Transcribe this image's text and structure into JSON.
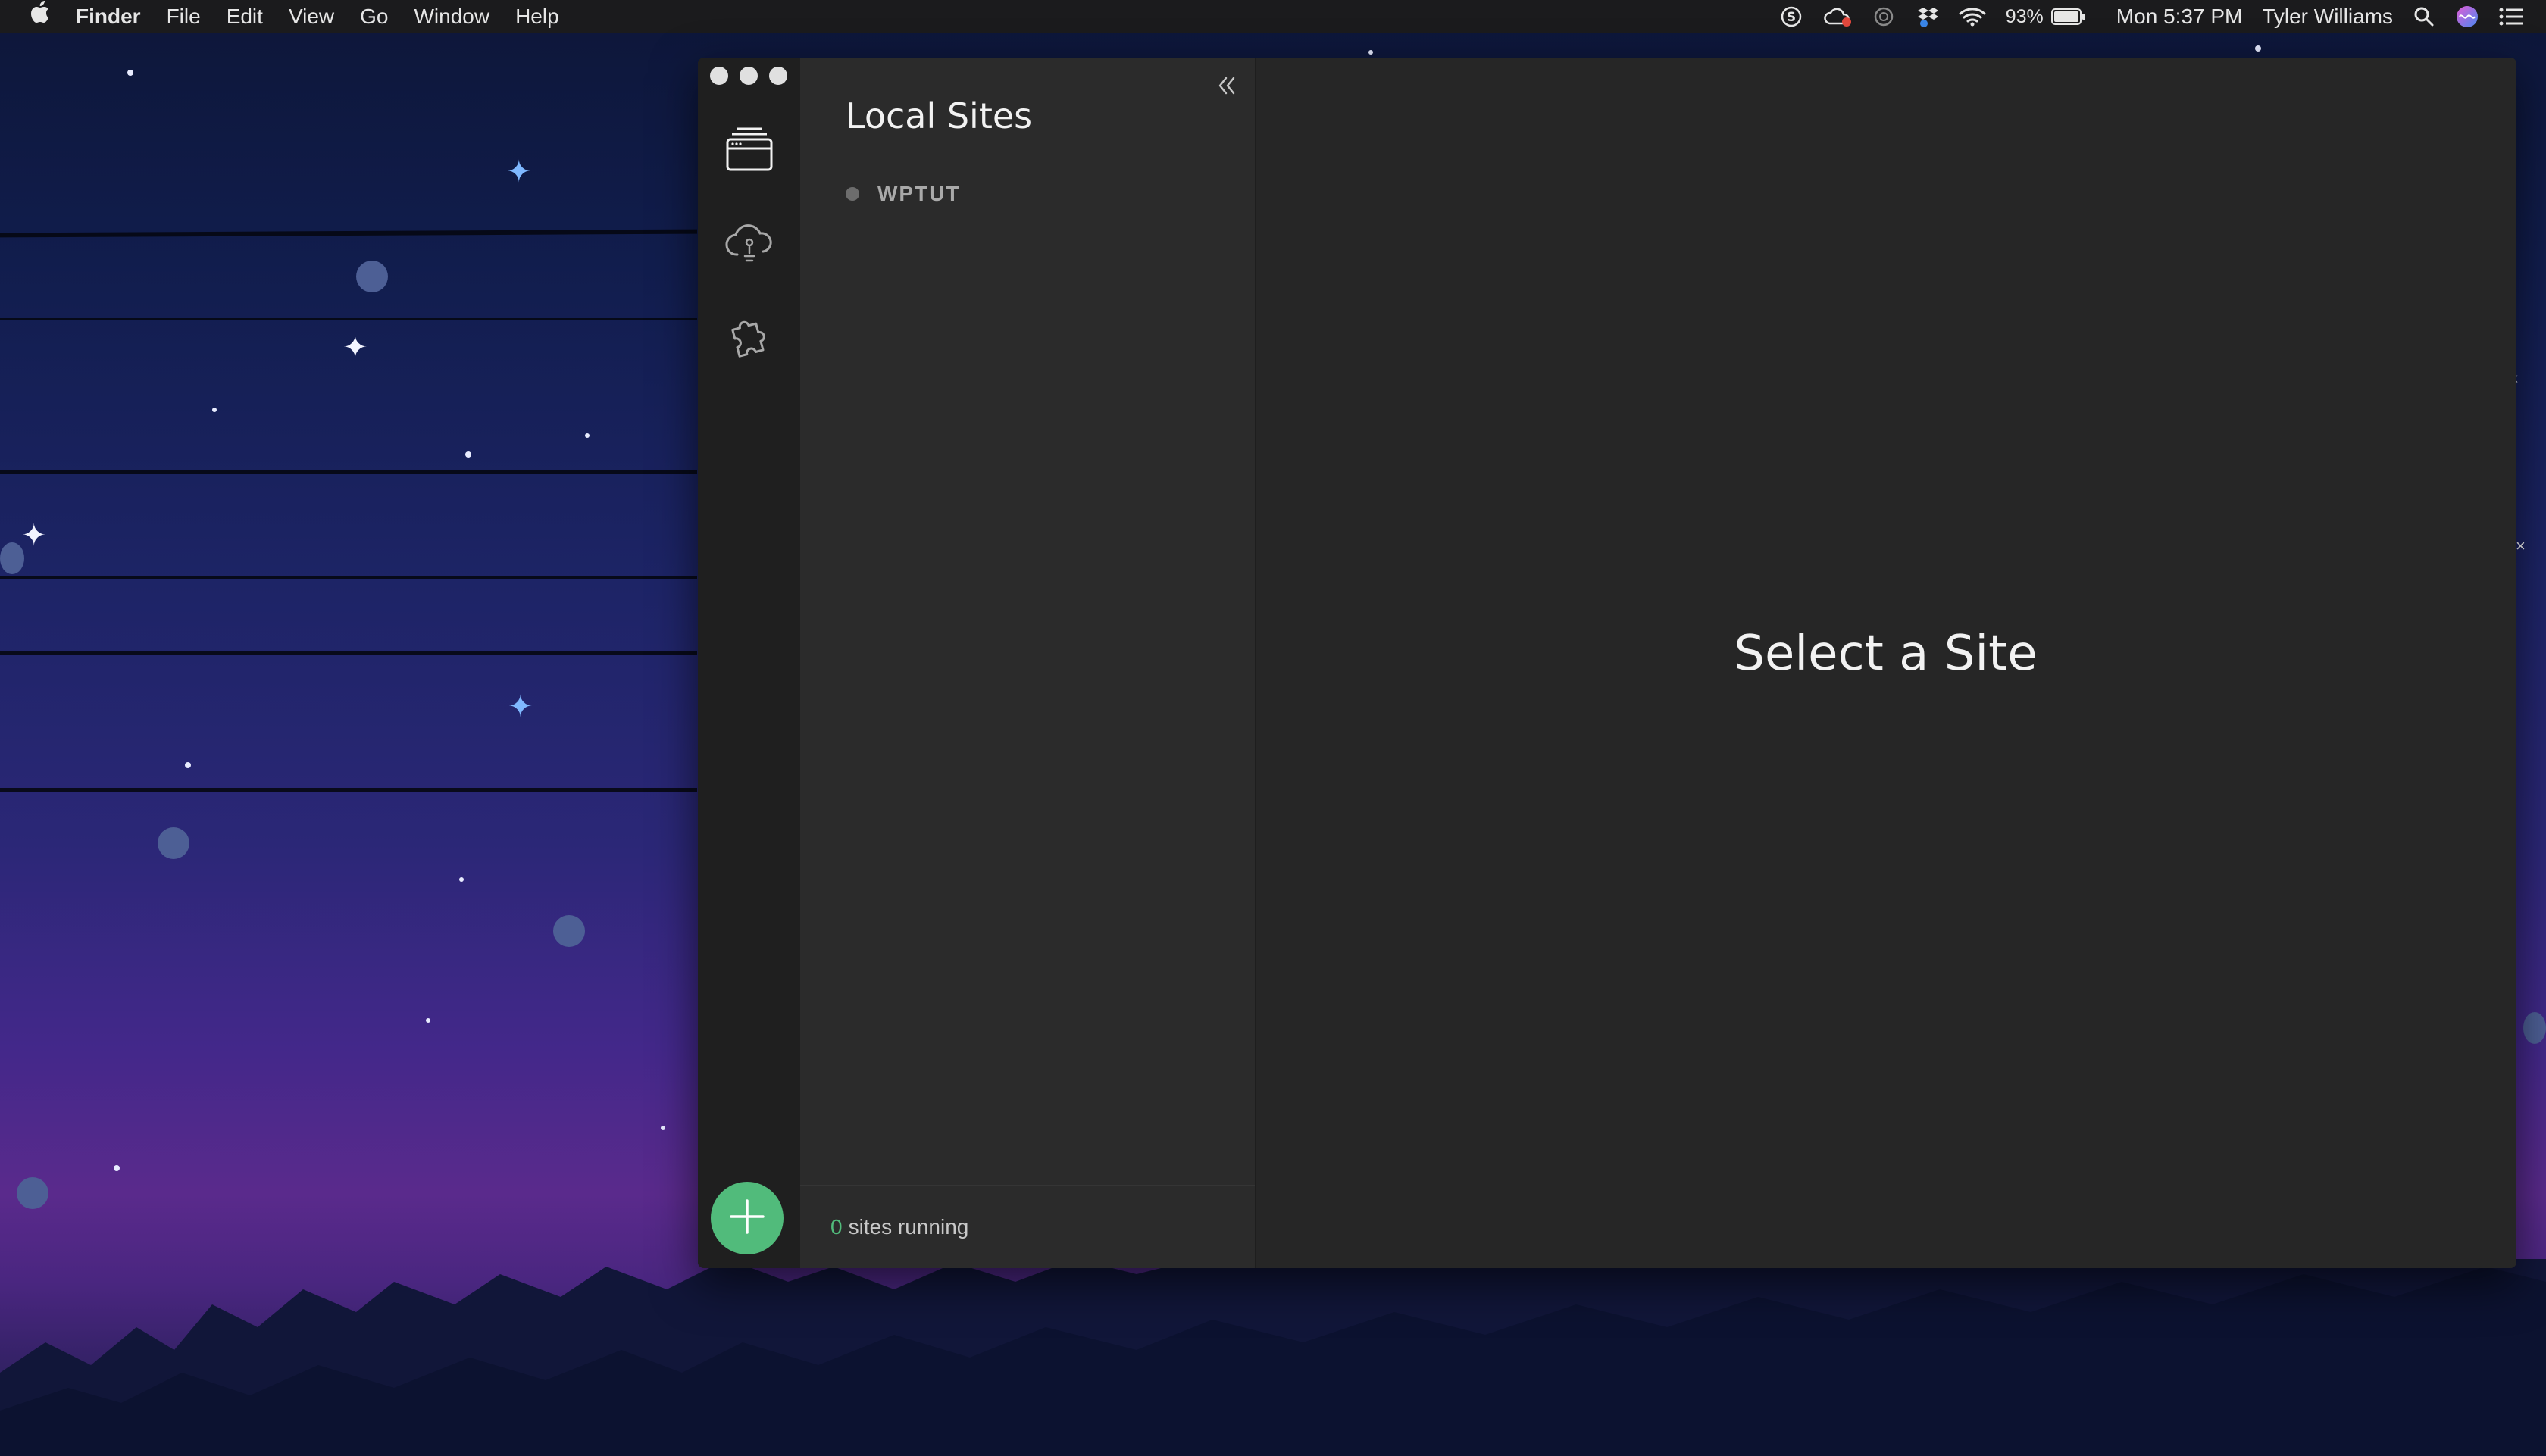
{
  "menubar": {
    "apple_icon": "apple-icon",
    "app_name": "Finder",
    "menus": [
      "File",
      "Edit",
      "View",
      "Go",
      "Window",
      "Help"
    ],
    "status_icons": [
      "skype-icon",
      "creative-cloud-icon",
      "night-shift-icon",
      "dropbox-icon",
      "wifi-icon"
    ],
    "battery": "93%",
    "clock": "Mon 5:37 PM",
    "user": "Tyler Williams"
  },
  "window": {
    "traffic_lights": [
      "close",
      "minimize",
      "zoom"
    ],
    "nav_icons": [
      "local-sites-icon",
      "connect-cloud-icon",
      "addons-puzzle-icon"
    ],
    "add_button_icon": "plus-icon"
  },
  "sidebar": {
    "title": "Local Sites",
    "collapse_icon": "double-chevron-left-icon",
    "sites": [
      {
        "name": "WPTUT",
        "status": "stopped"
      }
    ],
    "footer": {
      "count": "0",
      "label": "sites running"
    }
  },
  "main": {
    "message": "Select a Site"
  },
  "colors": {
    "accent_green": "#51bb7b",
    "window_bg": "#262626",
    "sidebar_bg": "#2b2b2b",
    "iconbar_bg": "#1f1f1f"
  }
}
